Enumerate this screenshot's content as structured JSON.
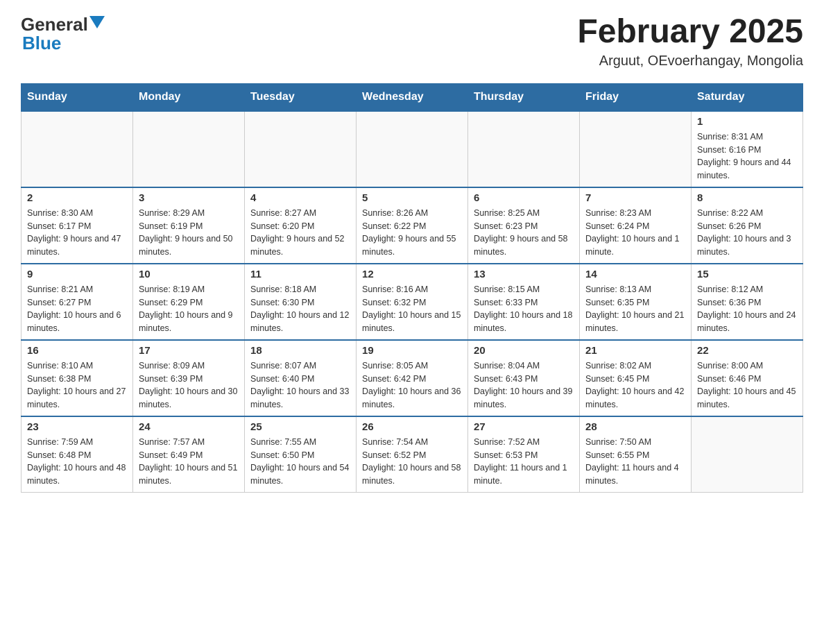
{
  "header": {
    "logo_general": "General",
    "logo_blue": "Blue",
    "title": "February 2025",
    "subtitle": "Arguut, OEvoerhangay, Mongolia"
  },
  "weekdays": [
    "Sunday",
    "Monday",
    "Tuesday",
    "Wednesday",
    "Thursday",
    "Friday",
    "Saturday"
  ],
  "weeks": [
    [
      {
        "day": "",
        "info": ""
      },
      {
        "day": "",
        "info": ""
      },
      {
        "day": "",
        "info": ""
      },
      {
        "day": "",
        "info": ""
      },
      {
        "day": "",
        "info": ""
      },
      {
        "day": "",
        "info": ""
      },
      {
        "day": "1",
        "info": "Sunrise: 8:31 AM\nSunset: 6:16 PM\nDaylight: 9 hours and 44 minutes."
      }
    ],
    [
      {
        "day": "2",
        "info": "Sunrise: 8:30 AM\nSunset: 6:17 PM\nDaylight: 9 hours and 47 minutes."
      },
      {
        "day": "3",
        "info": "Sunrise: 8:29 AM\nSunset: 6:19 PM\nDaylight: 9 hours and 50 minutes."
      },
      {
        "day": "4",
        "info": "Sunrise: 8:27 AM\nSunset: 6:20 PM\nDaylight: 9 hours and 52 minutes."
      },
      {
        "day": "5",
        "info": "Sunrise: 8:26 AM\nSunset: 6:22 PM\nDaylight: 9 hours and 55 minutes."
      },
      {
        "day": "6",
        "info": "Sunrise: 8:25 AM\nSunset: 6:23 PM\nDaylight: 9 hours and 58 minutes."
      },
      {
        "day": "7",
        "info": "Sunrise: 8:23 AM\nSunset: 6:24 PM\nDaylight: 10 hours and 1 minute."
      },
      {
        "day": "8",
        "info": "Sunrise: 8:22 AM\nSunset: 6:26 PM\nDaylight: 10 hours and 3 minutes."
      }
    ],
    [
      {
        "day": "9",
        "info": "Sunrise: 8:21 AM\nSunset: 6:27 PM\nDaylight: 10 hours and 6 minutes."
      },
      {
        "day": "10",
        "info": "Sunrise: 8:19 AM\nSunset: 6:29 PM\nDaylight: 10 hours and 9 minutes."
      },
      {
        "day": "11",
        "info": "Sunrise: 8:18 AM\nSunset: 6:30 PM\nDaylight: 10 hours and 12 minutes."
      },
      {
        "day": "12",
        "info": "Sunrise: 8:16 AM\nSunset: 6:32 PM\nDaylight: 10 hours and 15 minutes."
      },
      {
        "day": "13",
        "info": "Sunrise: 8:15 AM\nSunset: 6:33 PM\nDaylight: 10 hours and 18 minutes."
      },
      {
        "day": "14",
        "info": "Sunrise: 8:13 AM\nSunset: 6:35 PM\nDaylight: 10 hours and 21 minutes."
      },
      {
        "day": "15",
        "info": "Sunrise: 8:12 AM\nSunset: 6:36 PM\nDaylight: 10 hours and 24 minutes."
      }
    ],
    [
      {
        "day": "16",
        "info": "Sunrise: 8:10 AM\nSunset: 6:38 PM\nDaylight: 10 hours and 27 minutes."
      },
      {
        "day": "17",
        "info": "Sunrise: 8:09 AM\nSunset: 6:39 PM\nDaylight: 10 hours and 30 minutes."
      },
      {
        "day": "18",
        "info": "Sunrise: 8:07 AM\nSunset: 6:40 PM\nDaylight: 10 hours and 33 minutes."
      },
      {
        "day": "19",
        "info": "Sunrise: 8:05 AM\nSunset: 6:42 PM\nDaylight: 10 hours and 36 minutes."
      },
      {
        "day": "20",
        "info": "Sunrise: 8:04 AM\nSunset: 6:43 PM\nDaylight: 10 hours and 39 minutes."
      },
      {
        "day": "21",
        "info": "Sunrise: 8:02 AM\nSunset: 6:45 PM\nDaylight: 10 hours and 42 minutes."
      },
      {
        "day": "22",
        "info": "Sunrise: 8:00 AM\nSunset: 6:46 PM\nDaylight: 10 hours and 45 minutes."
      }
    ],
    [
      {
        "day": "23",
        "info": "Sunrise: 7:59 AM\nSunset: 6:48 PM\nDaylight: 10 hours and 48 minutes."
      },
      {
        "day": "24",
        "info": "Sunrise: 7:57 AM\nSunset: 6:49 PM\nDaylight: 10 hours and 51 minutes."
      },
      {
        "day": "25",
        "info": "Sunrise: 7:55 AM\nSunset: 6:50 PM\nDaylight: 10 hours and 54 minutes."
      },
      {
        "day": "26",
        "info": "Sunrise: 7:54 AM\nSunset: 6:52 PM\nDaylight: 10 hours and 58 minutes."
      },
      {
        "day": "27",
        "info": "Sunrise: 7:52 AM\nSunset: 6:53 PM\nDaylight: 11 hours and 1 minute."
      },
      {
        "day": "28",
        "info": "Sunrise: 7:50 AM\nSunset: 6:55 PM\nDaylight: 11 hours and 4 minutes."
      },
      {
        "day": "",
        "info": ""
      }
    ]
  ]
}
